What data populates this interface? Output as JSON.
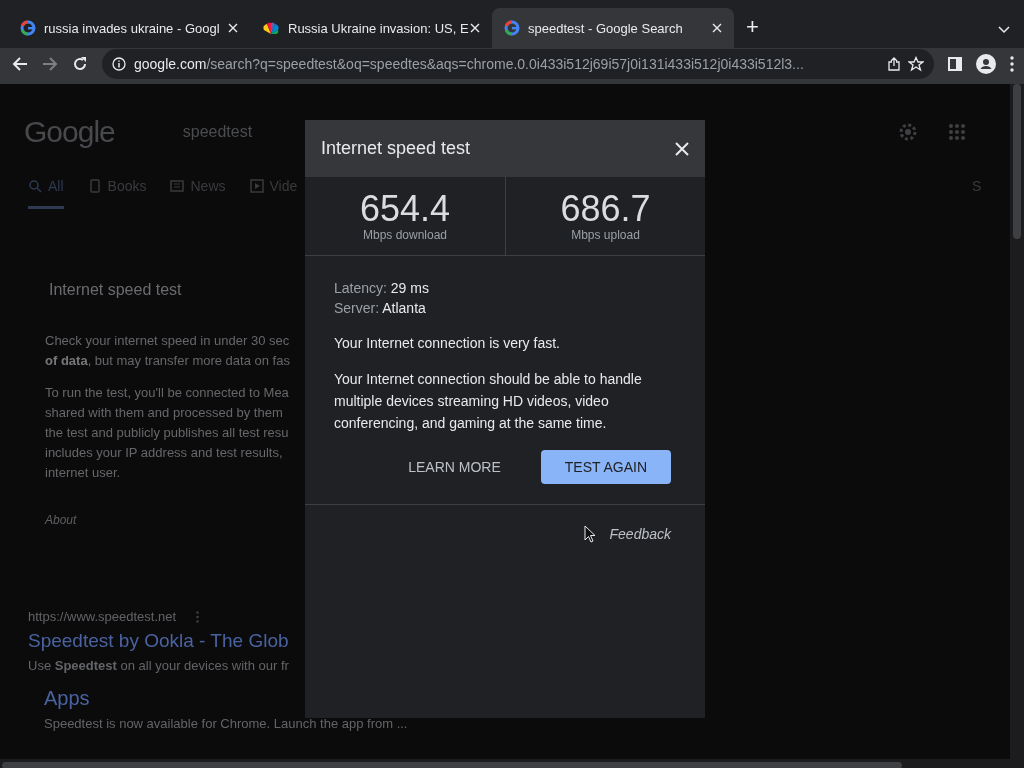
{
  "browser": {
    "tabs": [
      {
        "kind": "google",
        "title": "russia invades ukraine - Googl",
        "selected": false
      },
      {
        "kind": "news",
        "title": "Russia Ukraine invasion: US, E",
        "selected": false
      },
      {
        "kind": "google",
        "title": "speedtest - Google Search",
        "selected": true
      }
    ],
    "new_tab": "+",
    "address": {
      "host": "google.com",
      "path": "/search?q=speedtest&oq=speedtes&aqs=chrome.0.0i433i512j69i57j0i131i433i512j0i433i512l3..."
    }
  },
  "page": {
    "logo": "Google",
    "search": "speedtest",
    "nav": [
      {
        "kind": "search",
        "label": "All",
        "selected": true
      },
      {
        "kind": "book",
        "label": "Books",
        "selected": false
      },
      {
        "kind": "news",
        "label": "News",
        "selected": false
      },
      {
        "kind": "video",
        "label": "Vide",
        "selected": false
      }
    ],
    "nav_cut": "S",
    "card": {
      "title": "Internet speed test",
      "paragraphs": [
        [
          "Check your internet speed in under 30 sec",
          "**of data**, but may transfer more data on fas"
        ],
        [
          "To run the test, you'll be connected to Mea",
          "shared with them and processed by them",
          "the test and publicly publishes all test resu",
          "includes your IP address and test results,",
          "internet user."
        ]
      ],
      "about": "About"
    },
    "result": {
      "url": "https://www.speedtest.net",
      "title": "Speedtest by Ookla - The Glob",
      "snippet": "Use **Speedtest** on all your devices with our fr",
      "sublink": "Apps",
      "sub_snippet": "Speedtest is now available for Chrome. Launch the app from ..."
    }
  },
  "dialog": {
    "title": "Internet speed test",
    "results": [
      {
        "value": "654.4",
        "label": "Mbps download"
      },
      {
        "value": "686.7",
        "label": "Mbps upload"
      }
    ],
    "details": [
      {
        "label": "Latency:",
        "value": "29 ms"
      },
      {
        "label": "Server:",
        "value": "Atlanta"
      }
    ],
    "messages": [
      "Your Internet connection is very fast.",
      "Your Internet connection should be able to handle multiple devices streaming HD videos, video conferencing, and gaming at the same time."
    ],
    "buttons": [
      {
        "kind": "text",
        "label": "LEARN MORE"
      },
      {
        "kind": "filled",
        "label": "TEST AGAIN"
      }
    ],
    "feedback": "Feedback"
  }
}
